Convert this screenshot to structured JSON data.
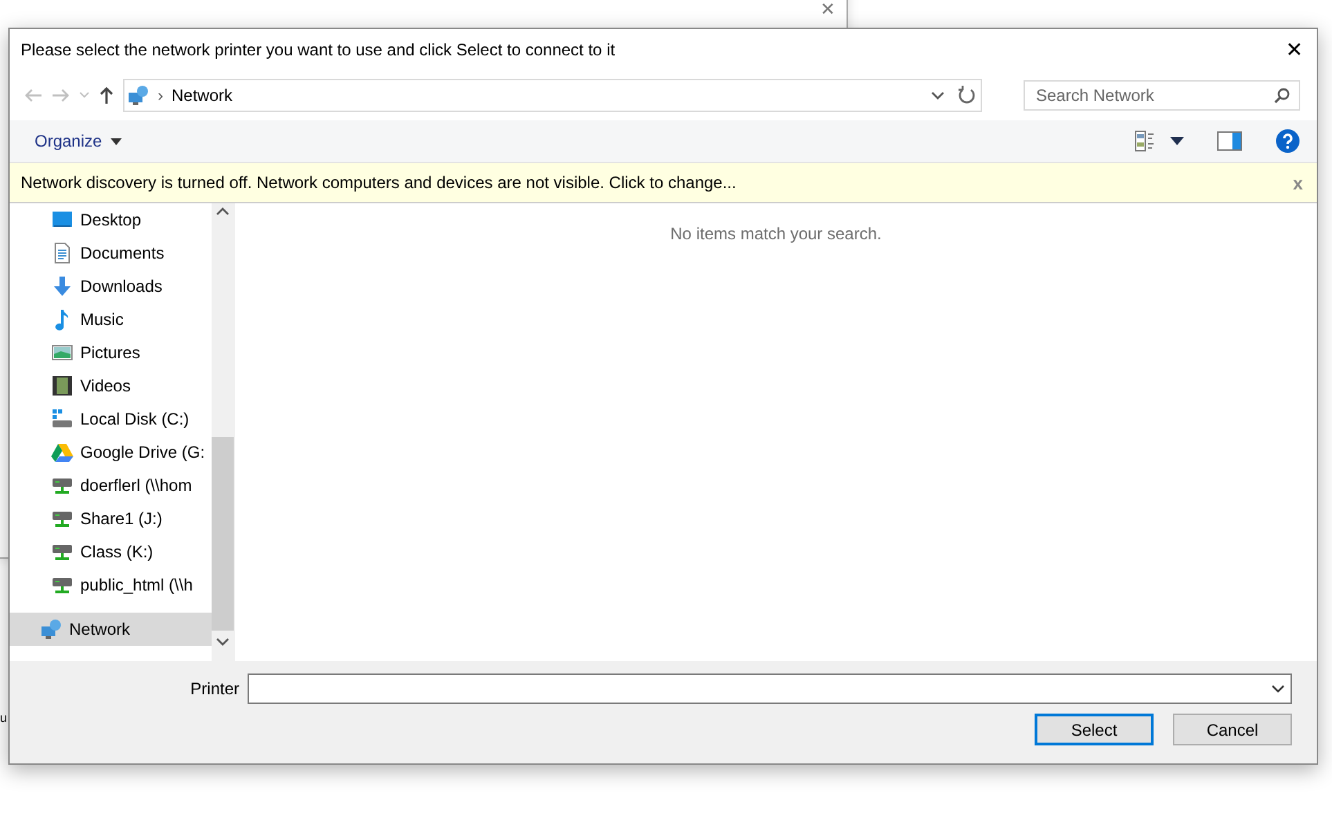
{
  "background_window": {
    "close_glyph": "✕",
    "fragment": "u"
  },
  "dialog": {
    "title": "Please select the network printer you want to use and click Select to connect to it",
    "close_glyph": "✕"
  },
  "address_bar": {
    "path": "Network",
    "separator": "›"
  },
  "search": {
    "placeholder": "Search Network"
  },
  "toolbar": {
    "organize": "Organize"
  },
  "info_bar": {
    "message": "Network discovery is turned off. Network computers and devices are not visible. Click to change...",
    "close_glyph": "x"
  },
  "sidebar": {
    "items": [
      {
        "label": "Desktop",
        "kind": "desktop",
        "selected": false
      },
      {
        "label": "Documents",
        "kind": "documents",
        "selected": false
      },
      {
        "label": "Downloads",
        "kind": "downloads",
        "selected": false
      },
      {
        "label": "Music",
        "kind": "music",
        "selected": false
      },
      {
        "label": "Pictures",
        "kind": "pictures",
        "selected": false
      },
      {
        "label": "Videos",
        "kind": "videos",
        "selected": false
      },
      {
        "label": "Local Disk (C:)",
        "kind": "disk",
        "selected": false
      },
      {
        "label": "Google Drive (G:",
        "kind": "cloud",
        "selected": false
      },
      {
        "label": "doerflerl (\\\\hom",
        "kind": "share",
        "selected": false
      },
      {
        "label": "Share1 (J:)",
        "kind": "share",
        "selected": false
      },
      {
        "label": "Class (K:)",
        "kind": "share",
        "selected": false
      },
      {
        "label": "public_html (\\\\h",
        "kind": "share",
        "selected": false
      },
      {
        "label": "Network",
        "kind": "network",
        "selected": true
      }
    ]
  },
  "content": {
    "empty_message": "No items match your search."
  },
  "printer_field": {
    "label": "Printer"
  },
  "buttons": [
    {
      "label": "Select",
      "default": true
    },
    {
      "label": "Cancel",
      "default": false
    }
  ]
}
